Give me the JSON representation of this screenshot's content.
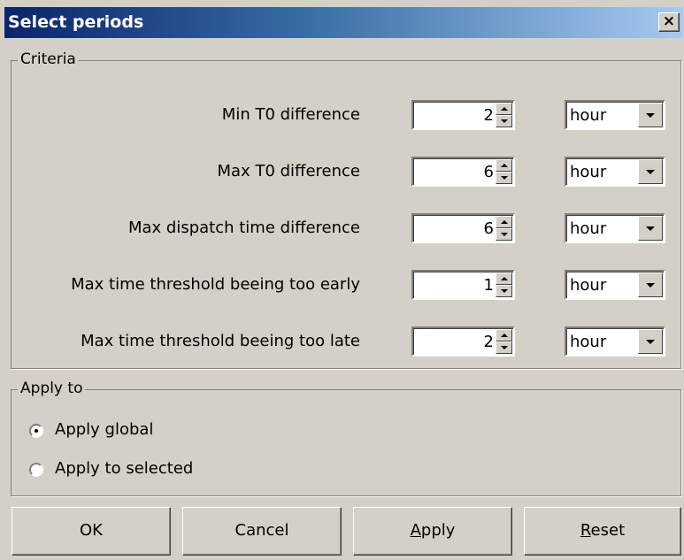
{
  "window": {
    "title": "Select periods",
    "close_glyph": "×"
  },
  "criteria": {
    "legend": "Criteria",
    "rows": [
      {
        "label": "Min T0 difference",
        "value": "2",
        "unit": "hour"
      },
      {
        "label": "Max T0 difference",
        "value": "6",
        "unit": "hour"
      },
      {
        "label": "Max dispatch time difference",
        "value": "6",
        "unit": "hour"
      },
      {
        "label": "Max time threshold beeing too early",
        "value": "1",
        "unit": "hour"
      },
      {
        "label": "Max time threshold beeing too late",
        "value": "2",
        "unit": "hour"
      }
    ]
  },
  "apply_to": {
    "legend": "Apply to",
    "options": [
      {
        "label": "Apply global",
        "checked": true
      },
      {
        "label": "Apply to selected",
        "checked": false
      }
    ]
  },
  "buttons": {
    "ok": "OK",
    "cancel": "Cancel",
    "apply_mnemonic": "A",
    "apply_rest": "pply",
    "reset_mnemonic": "R",
    "reset_rest": "eset"
  }
}
